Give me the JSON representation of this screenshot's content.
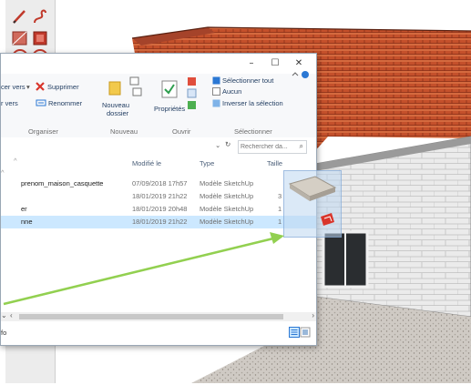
{
  "explorer": {
    "titlebar": {
      "minimize": "–",
      "maximize": "☐",
      "close": "✕"
    },
    "ribbon": {
      "copy_to": "cer vers",
      "move_to": "r vers",
      "delete": "Supprimer",
      "rename": "Renommer",
      "new_folder_line1": "Nouveau",
      "new_folder_line2": "dossier",
      "properties": "Propriétés",
      "select_all": "Sélectionner tout",
      "select_none": "Aucun",
      "invert_selection": "Inverser la sélection",
      "groups": {
        "organize": "Organiser",
        "new": "Nouveau",
        "open": "Ouvrir",
        "select": "Sélectionner"
      }
    },
    "search": {
      "placeholder": "Rechercher da..."
    },
    "columns": {
      "modified": "Modifié le",
      "type": "Type",
      "size": "Taille"
    },
    "files": [
      {
        "name": "prenom_maison_casquette",
        "modified": "07/09/2018 17h57",
        "type": "Modèle SketchUp",
        "size": "",
        "selected": false
      },
      {
        "name": "",
        "modified": "18/01/2019 21h22",
        "type": "Modèle SketchUp",
        "size": "3",
        "selected": false
      },
      {
        "name": "er",
        "modified": "18/01/2019 20h48",
        "type": "Modèle SketchUp",
        "size": "1",
        "selected": false
      },
      {
        "name": "nne",
        "modified": "18/01/2019 21h22",
        "type": "Modèle SketchUp",
        "size": "1",
        "selected": true
      }
    ],
    "status": {
      "left": "fo"
    }
  },
  "colors": {
    "arrow": "#92d050",
    "roof": "#c4502b",
    "wall": "#e8e8e8",
    "selection": "#cce8ff",
    "accent_blue": "#2b78d4",
    "sketchup_red": "#d9352b"
  }
}
